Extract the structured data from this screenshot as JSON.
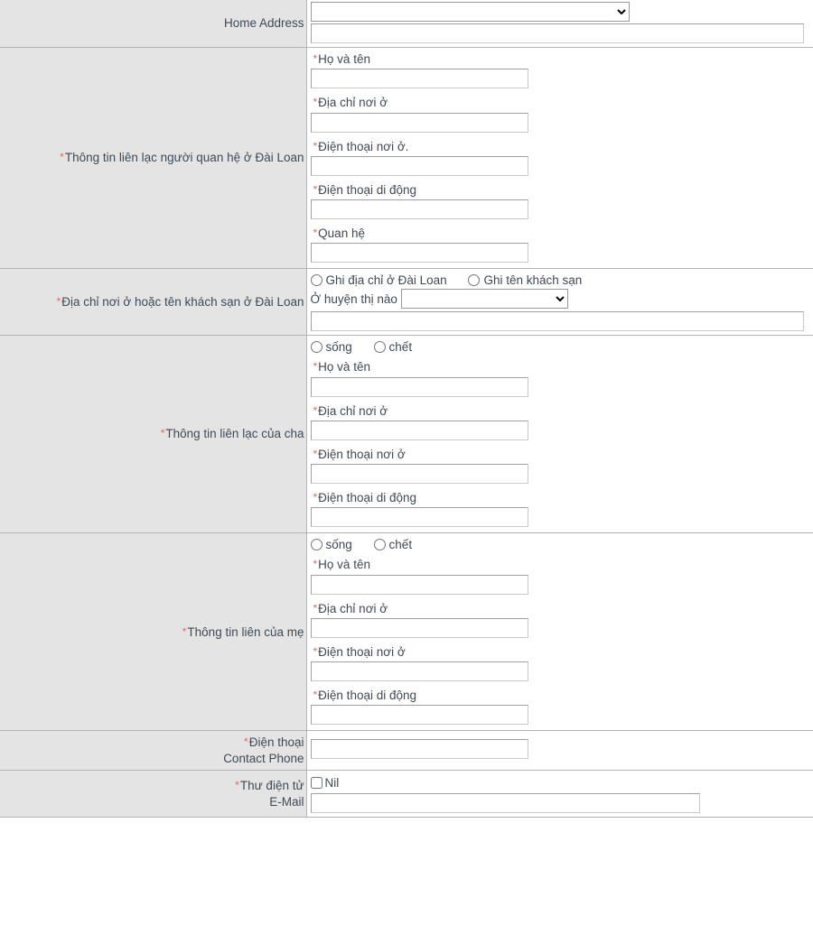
{
  "rows": [
    {
      "id": "home-address",
      "label_plain": "Home Address",
      "required": false,
      "select_value": "",
      "text_value": ""
    },
    {
      "id": "taiwan-contact",
      "label_plain": "Thông tin liên lạc người quan hệ ở Đài Loan",
      "required": true,
      "fields": [
        {
          "label": "Họ và tên",
          "required": true,
          "value": ""
        },
        {
          "label": "Địa chỉ nơi ở",
          "required": true,
          "value": ""
        },
        {
          "label": "Điện thoại nơi ở.",
          "required": true,
          "value": ""
        },
        {
          "label": "Điện thoại di động",
          "required": true,
          "value": ""
        },
        {
          "label": "Quan hệ",
          "required": true,
          "value": ""
        }
      ]
    },
    {
      "id": "taiwan-address",
      "label_plain": "Địa chỉ nơi ở hoặc tên khách sạn ở Đài Loan",
      "required": true,
      "radios": [
        {
          "label": "Ghi địa chỉ ở Đài Loan",
          "checked": false
        },
        {
          "label": "Ghi tên khách sạn",
          "checked": false
        }
      ],
      "county_label": "Ở huyện thị nào",
      "county_value": "",
      "address_value": ""
    },
    {
      "id": "father-contact",
      "label_plain": "Thông tin liên lạc của cha",
      "required": true,
      "status_radios": [
        {
          "label": "sống",
          "checked": false
        },
        {
          "label": "chết",
          "checked": false
        }
      ],
      "fields": [
        {
          "label": "Họ và tên",
          "required": true,
          "value": ""
        },
        {
          "label": "Địa chỉ nơi ở",
          "required": true,
          "value": ""
        },
        {
          "label": "Điện thoại nơi ở",
          "required": true,
          "value": ""
        },
        {
          "label": "Điện thoại di động",
          "required": true,
          "value": ""
        }
      ]
    },
    {
      "id": "mother-contact",
      "label_plain": "Thông tin liên của mẹ",
      "required": true,
      "status_radios": [
        {
          "label": "sống",
          "checked": false
        },
        {
          "label": "chết",
          "checked": false
        }
      ],
      "fields": [
        {
          "label": "Họ và tên",
          "required": true,
          "value": ""
        },
        {
          "label": "Địa chỉ nơi ở",
          "required": true,
          "value": ""
        },
        {
          "label": "Điện thoại nơi ở",
          "required": true,
          "value": ""
        },
        {
          "label": "Điện thoại di động",
          "required": true,
          "value": ""
        }
      ]
    },
    {
      "id": "contact-phone",
      "label_line1": "Điện thoại",
      "label_line2": "Contact Phone",
      "required": true,
      "value": ""
    },
    {
      "id": "email",
      "label_line1": "Thư điện tử",
      "label_line2": "E-Mail",
      "required": true,
      "nil_label": "Nil",
      "nil_checked": false,
      "value": ""
    }
  ],
  "home_address": {
    "label": "Home Address",
    "select_value": "",
    "text_value": ""
  },
  "taiwan_contact": {
    "label": "Thông tin liên lạc người quan hệ ở Đài Loan",
    "name_label": "Họ và tên",
    "name_value": "",
    "address_label": "Địa chỉ nơi ở",
    "address_value": "",
    "home_phone_label": "Điện thoại nơi ở.",
    "home_phone_value": "",
    "mobile_label": "Điện thoại di động",
    "mobile_value": "",
    "relation_label": "Quan hệ",
    "relation_value": ""
  },
  "taiwan_address": {
    "label": "Địa chỉ nơi ở hoặc tên khách sạn ở Đài Loan",
    "radio_address_label": "Ghi địa chỉ ở Đài Loan",
    "radio_hotel_label": "Ghi tên khách sạn",
    "county_label": "Ở huyện thị nào",
    "county_value": "",
    "address_value": ""
  },
  "father": {
    "label": "Thông tin liên lạc của cha",
    "alive_label": "sống",
    "dead_label": "chết",
    "name_label": "Họ và tên",
    "name_value": "",
    "address_label": "Địa chỉ nơi ở",
    "address_value": "",
    "home_phone_label": "Điện thoại nơi ở",
    "home_phone_value": "",
    "mobile_label": "Điện thoại di động",
    "mobile_value": ""
  },
  "mother": {
    "label": "Thông tin liên của mẹ",
    "alive_label": "sống",
    "dead_label": "chết",
    "name_label": "Họ và tên",
    "name_value": "",
    "address_label": "Địa chỉ nơi ở",
    "address_value": "",
    "home_phone_label": "Điện thoại nơi ở",
    "home_phone_value": "",
    "mobile_label": "Điện thoại di động",
    "mobile_value": ""
  },
  "contact_phone": {
    "label_vi": "Điện thoại",
    "label_en": "Contact Phone",
    "value": ""
  },
  "email": {
    "label_vi": "Thư điện tử",
    "label_en": "E-Mail",
    "nil_label": "Nil",
    "value": ""
  },
  "colors": {
    "label_background": "#e4e4e4",
    "border": "#b5b5b5",
    "required_asterisk": "#e8675c",
    "text": "#3f4a56",
    "field_border": "#a0a0a0"
  }
}
